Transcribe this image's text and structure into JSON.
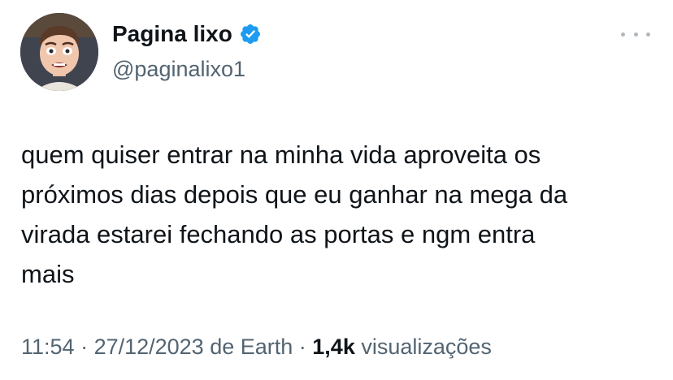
{
  "author": {
    "display_name": "Pagina lixo",
    "handle": "@paginalixo1",
    "verified": true
  },
  "tweet": {
    "text": "quem quiser entrar na minha vida aproveita os\npróximos dias depois que eu ganhar na mega da\nvirada estarei fechando as portas e ngm entra\nmais"
  },
  "meta": {
    "time": "11:54",
    "separator1": " · ",
    "date": "27/12/2023",
    "location": " de Earth",
    "separator2": " · ",
    "views_count": "1,4k",
    "views_label": " visualizações"
  },
  "icons": {
    "more": "more-horizontal-icon",
    "verified": "verified-badge-icon"
  },
  "colors": {
    "verified_blue": "#1d9bf0",
    "secondary_text": "#536471",
    "primary_text": "#0f1419"
  }
}
